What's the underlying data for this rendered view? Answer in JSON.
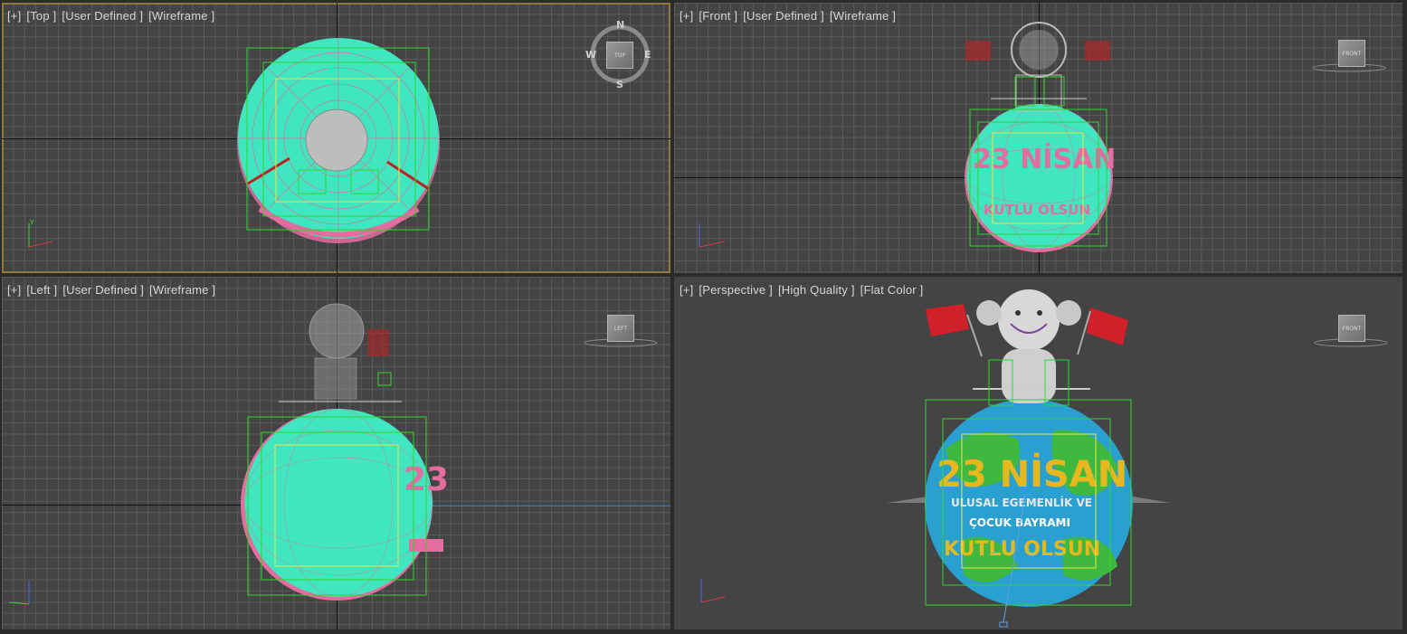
{
  "viewports": {
    "top": {
      "labels": [
        "[+]",
        "[Top ]",
        "[User Defined ]",
        "[Wireframe ]"
      ],
      "compass": {
        "n": "N",
        "s": "S",
        "e": "E",
        "w": "W",
        "cube": "TOP"
      }
    },
    "front": {
      "labels": [
        "[+]",
        "[Front ]",
        "[User Defined ]",
        "[Wireframe ]"
      ],
      "cube": "FRONT"
    },
    "left": {
      "labels": [
        "[+]",
        "[Left ]",
        "[User Defined ]",
        "[Wireframe ]"
      ],
      "cube": "LEFT"
    },
    "perspective": {
      "labels": [
        "[+]",
        "[Perspective ]",
        "[High Quality ]",
        "[Flat Color ]"
      ],
      "cube": "FRONT"
    }
  },
  "globe_text": {
    "line1": "23 NİSAN",
    "line2": "ULUSAL EGEMENLİK VE",
    "line3": "ÇOCUK BAYRAMI",
    "line4": "KUTLU OLSUN"
  },
  "side_text": "23",
  "colors": {
    "wire_cyan": "#3fe6c0",
    "wire_pink": "#e46c9e",
    "select_green": "#2fd62f",
    "select_yellow": "#e8e84a",
    "flag_red": "#d0202a",
    "text_gold": "#e6b820",
    "globe_blue": "#2aa0d0",
    "globe_green": "#3fb83f"
  }
}
